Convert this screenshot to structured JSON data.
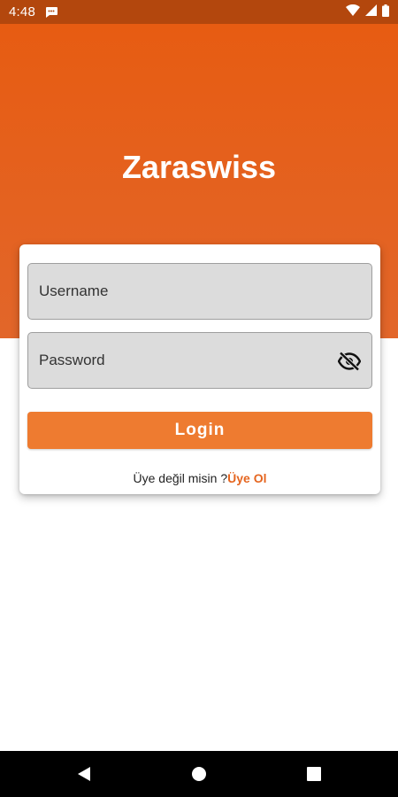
{
  "status_bar": {
    "time": "4:48",
    "icons": [
      "chat-notification-icon",
      "wifi-icon",
      "signal-icon",
      "battery-icon"
    ]
  },
  "app": {
    "title": "Zaraswiss"
  },
  "login_form": {
    "username_placeholder": "Username",
    "password_placeholder": "Password",
    "password_toggle_icon": "eye-off-icon",
    "login_label": "Login",
    "signup_prompt": "Üye değil misin ?",
    "signup_link": "Üye Ol"
  },
  "nav_bar": {
    "buttons": [
      "back-icon",
      "home-icon",
      "recents-icon"
    ]
  },
  "colors": {
    "status_bar": "#b3470d",
    "header_top": "#e75c12",
    "header_bottom": "#e2662a",
    "button": "#ee7b30",
    "link": "#e5651f",
    "field_bg": "#dcdcdc"
  }
}
